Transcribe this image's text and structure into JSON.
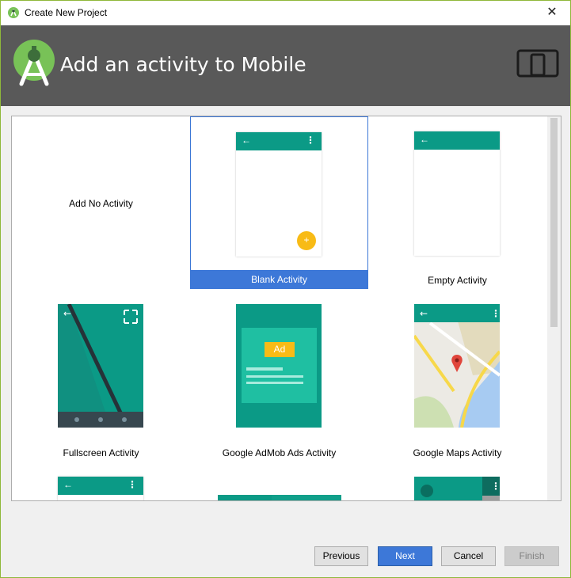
{
  "window": {
    "title": "Create New Project",
    "close_glyph": "✕",
    "border_color": "#8fb83a"
  },
  "banner": {
    "heading": "Add an activity to Mobile",
    "background": "#595959",
    "logo_icon": "android-studio-icon",
    "device_icon": "tablet-phone-icon"
  },
  "gallery": {
    "tiles": [
      {
        "label": "Add No Activity",
        "selected": false
      },
      {
        "label": "Blank Activity",
        "selected": true
      },
      {
        "label": "Empty Activity",
        "selected": false
      },
      {
        "label": "Fullscreen Activity",
        "selected": false
      },
      {
        "label": "Google AdMob Ads Activity",
        "selected": false
      },
      {
        "label": "Google Maps Activity",
        "selected": false
      }
    ],
    "ad_badge": "Ad",
    "fab_glyph": "+",
    "back_arrow": "←",
    "overflow_glyph": "⋮",
    "accent": "#0b9a86",
    "fab_color": "#f8bb16",
    "selection_color": "#3d78d8"
  },
  "buttons": {
    "previous": "Previous",
    "next": "Next",
    "cancel": "Cancel",
    "finish": "Finish"
  }
}
